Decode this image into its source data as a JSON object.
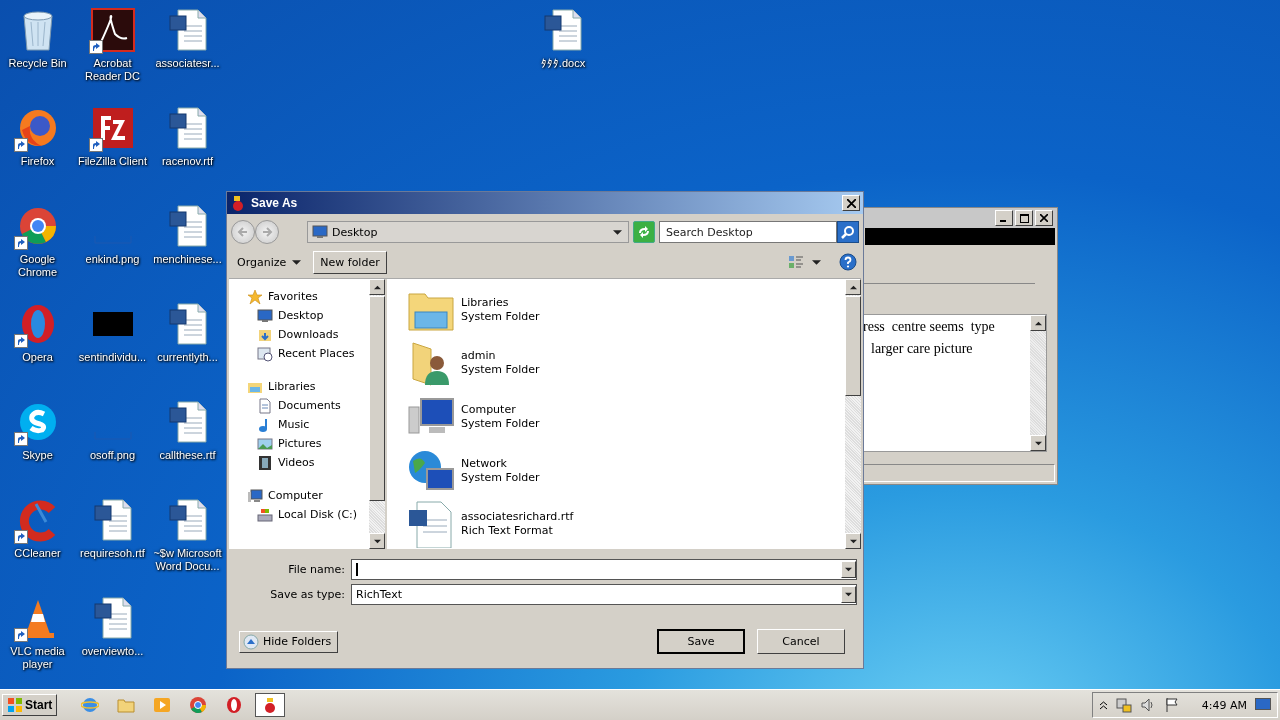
{
  "desktop_icons": [
    {
      "label": "Recycle Bin",
      "kind": "trash",
      "shortcut": false
    },
    {
      "label": "Firefox",
      "kind": "orb",
      "shortcut": true
    },
    {
      "label": "Google Chrome",
      "kind": "wheel",
      "shortcut": true
    },
    {
      "label": "Opera",
      "kind": "ring",
      "shortcut": true
    },
    {
      "label": "Skype",
      "kind": "cloud",
      "shortcut": true
    },
    {
      "label": "CCleaner",
      "kind": "arc",
      "shortcut": true
    },
    {
      "label": "VLC media player",
      "kind": "cone",
      "shortcut": true
    },
    {
      "label": "Acrobat Reader DC",
      "kind": "pdf",
      "shortcut": true
    },
    {
      "label": "FileZilla Client",
      "kind": "zigzag",
      "shortcut": true
    },
    {
      "label": "enkind.png",
      "kind": "blank",
      "shortcut": false
    },
    {
      "label": "sentindividu...",
      "kind": "dark",
      "shortcut": false
    },
    {
      "label": "osoff.png",
      "kind": "blank",
      "shortcut": false
    },
    {
      "label": "requiresoh.rtf",
      "kind": "doc",
      "shortcut": false
    },
    {
      "label": "overviewto...",
      "kind": "doc",
      "shortcut": false
    },
    {
      "label": "associatesr...",
      "kind": "doc",
      "shortcut": false
    },
    {
      "label": "racenov.rtf",
      "kind": "doc",
      "shortcut": false
    },
    {
      "label": "menchinese...",
      "kind": "doc",
      "shortcut": false
    },
    {
      "label": "currentlyth...",
      "kind": "doc",
      "shortcut": false
    },
    {
      "label": "callthese.rtf",
      "kind": "doc",
      "shortcut": false
    },
    {
      "label": "~$w Microsoft Word Docu...",
      "kind": "doc",
      "shortcut": false
    }
  ],
  "desktop_file": {
    "label": "ﾀﾀﾀ.docx",
    "kind": "doc"
  },
  "background_window": {
    "lines": [
      "ress  centre seems  type",
      "larger care picture"
    ]
  },
  "dialog": {
    "title": "Save As",
    "address": "Desktop",
    "search": {
      "placeholder": "Search Desktop"
    },
    "organize": "Organize",
    "new_folder": "New folder",
    "nav": [
      {
        "label": "Favorites",
        "kind": "star",
        "children": [
          {
            "label": "Desktop",
            "kind": "screen"
          },
          {
            "label": "Downloads",
            "kind": "download"
          },
          {
            "label": "Recent Places",
            "kind": "recent"
          }
        ]
      },
      {
        "label": "Libraries",
        "kind": "library",
        "children": [
          {
            "label": "Documents",
            "kind": "page"
          },
          {
            "label": "Music",
            "kind": "note"
          },
          {
            "label": "Pictures",
            "kind": "photo"
          },
          {
            "label": "Videos",
            "kind": "film"
          }
        ]
      },
      {
        "label": "Computer",
        "kind": "computer",
        "children": [
          {
            "label": "Local Disk (C:)",
            "kind": "disk"
          }
        ]
      }
    ],
    "files": [
      {
        "name": "Libraries",
        "type": "System Folder",
        "kind": "library"
      },
      {
        "name": "admin",
        "type": "System Folder",
        "kind": "user"
      },
      {
        "name": "Computer",
        "type": "System Folder",
        "kind": "computer"
      },
      {
        "name": "Network",
        "type": "System Folder",
        "kind": "network"
      },
      {
        "name": "associatesrichard.rtf",
        "type": "Rich Text Format",
        "kind": "doc"
      }
    ],
    "file_name": {
      "label": "File name:"
    },
    "save_type": {
      "label": "Save as type:",
      "value": "RichText"
    },
    "hide_folders": "Hide Folders",
    "buttons": [
      {
        "label": "Save",
        "default": true
      },
      {
        "label": "Cancel",
        "default": false
      }
    ]
  },
  "taskbar": {
    "start": "Start",
    "apps": [
      {
        "kind": "ie",
        "selected": false
      },
      {
        "kind": "folder",
        "selected": false
      },
      {
        "kind": "media",
        "selected": false
      },
      {
        "kind": "wheel",
        "selected": false
      },
      {
        "kind": "ring",
        "selected": false
      },
      {
        "kind": "fz",
        "selected": true
      }
    ],
    "clock": "4:49 AM"
  }
}
